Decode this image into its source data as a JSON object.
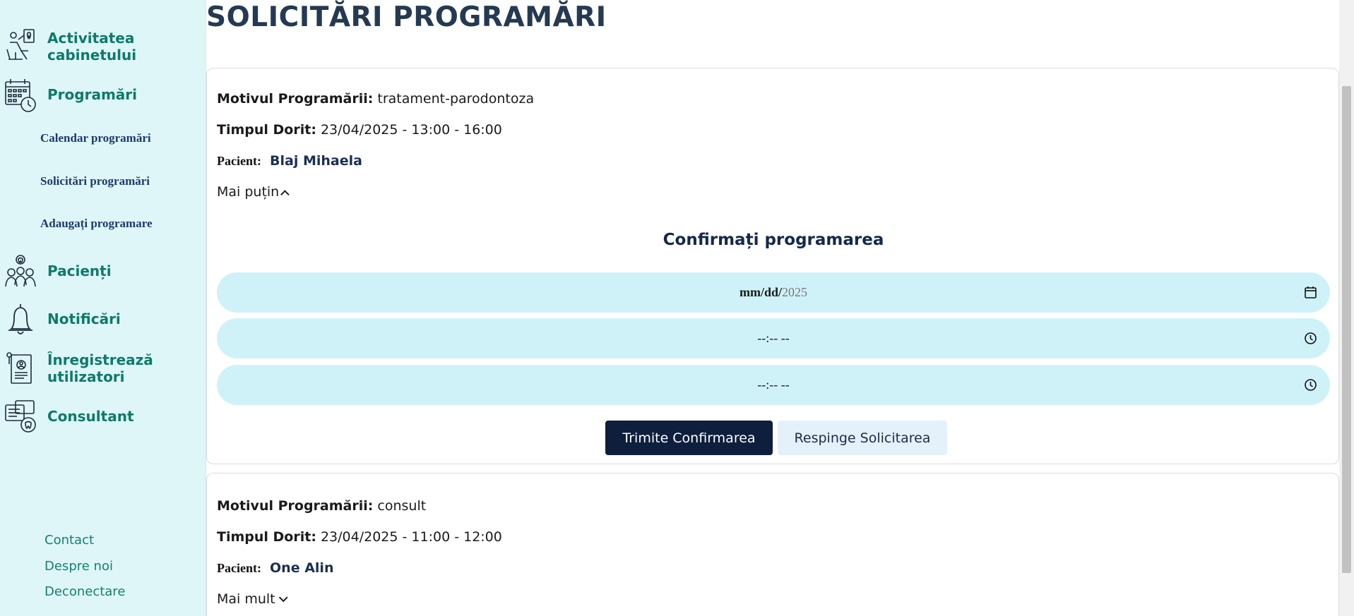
{
  "sidebar": {
    "items": [
      {
        "label_line1": "Activitatea",
        "label_line2": "cabinetului",
        "icon": "dentist-chair-icon"
      },
      {
        "label": "Programări",
        "icon": "calendar-clock-icon"
      },
      {
        "label": "Pacienți",
        "icon": "patients-group-icon"
      },
      {
        "label": "Notificări",
        "icon": "bell-icon"
      },
      {
        "label_line1": "Înregistrează",
        "label_line2": "utilizatori",
        "icon": "register-form-icon"
      },
      {
        "label": "Consultant",
        "icon": "consultant-chat-icon"
      }
    ],
    "subitems": [
      "Calendar programări",
      "Solicitări programări",
      "Adaugați programare"
    ],
    "footer": [
      "Contact",
      "Despre noi",
      "Deconectare"
    ]
  },
  "page": {
    "title": "SOLICITĂRI PROGRAMĂRI"
  },
  "requests": [
    {
      "reason_label": "Motivul Programării:",
      "reason": "tratament-parodontoza",
      "time_label": "Timpul Dorit:",
      "time": "23/04/2025 - 13:00 - 16:00",
      "patient_label": "Pacient:",
      "patient": "Blaj Mihaela",
      "toggle": "Mai puțin",
      "confirm": {
        "title": "Confirmați programarea",
        "date_placeholder_a": "mm/dd/",
        "date_placeholder_b": "2025",
        "start_time_placeholder": "--:-- --",
        "end_time_placeholder": "--:-- --",
        "submit_label": "Trimite Confirmarea",
        "reject_label": "Respinge Solicitarea"
      }
    },
    {
      "reason_label": "Motivul Programării:",
      "reason": "consult",
      "time_label": "Timpul Dorit:",
      "time": "23/04/2025 - 11:00 - 12:00",
      "patient_label": "Pacient:",
      "patient": "One Alin",
      "toggle": "Mai mult"
    }
  ],
  "colors": {
    "sidebar_bg": "#dff6f8",
    "nav_text": "#0e7a6a",
    "field_bg": "#cff2f8",
    "primary_button": "#0e1e3d",
    "secondary_button": "#e4f1fb"
  }
}
